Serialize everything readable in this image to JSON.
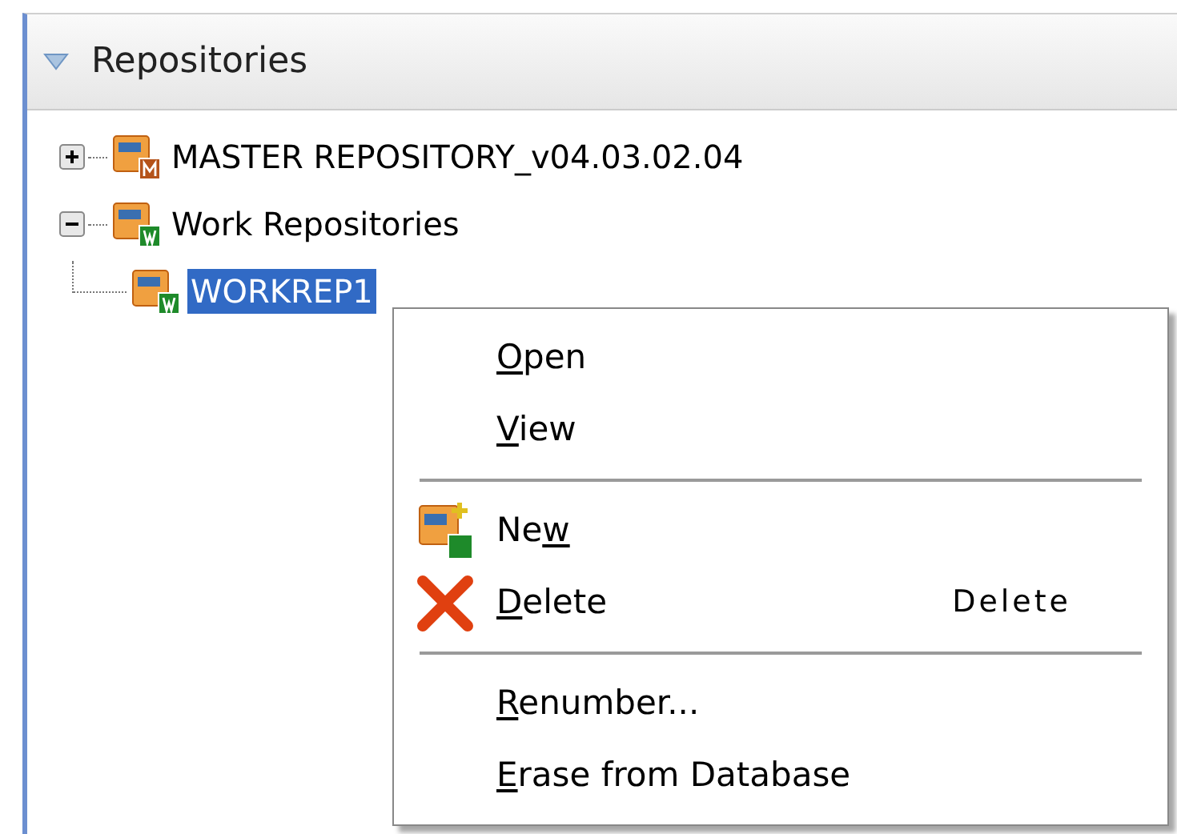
{
  "panel": {
    "title": "Repositories",
    "expanded": true
  },
  "tree": [
    {
      "label": "MASTER REPOSITORY_v04.03.02.04",
      "kind": "master",
      "expanded": false,
      "selected": false
    },
    {
      "label": "Work Repositories",
      "kind": "work",
      "expanded": true,
      "selected": false,
      "children": [
        {
          "label": "WORKREP1",
          "kind": "work",
          "selected": true
        }
      ]
    }
  ],
  "context_menu": [
    {
      "kind": "item",
      "key": "O",
      "rest": "pen"
    },
    {
      "kind": "item",
      "key": "V",
      "rest": "iew"
    },
    {
      "kind": "separator"
    },
    {
      "kind": "new",
      "pre": "Ne",
      "key": "w"
    },
    {
      "kind": "delete",
      "key": "D",
      "rest": "elete",
      "shortcut": "Delete"
    },
    {
      "kind": "separator"
    },
    {
      "kind": "item",
      "key": "R",
      "rest": "enumber..."
    },
    {
      "kind": "item",
      "key": "E",
      "rest": "rase from Database"
    }
  ]
}
